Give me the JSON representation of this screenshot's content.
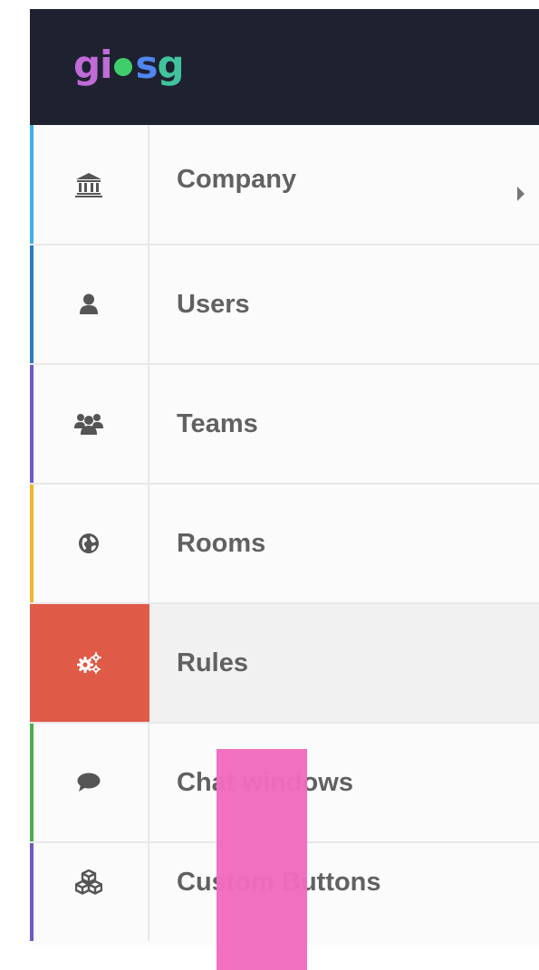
{
  "brand": {
    "logo_text_left": "gi",
    "logo_text_right": "sg",
    "logo_label": "giosg",
    "colors": {
      "left": "#c06bd6",
      "dot": "#3fce6b",
      "s": "#4f86f0",
      "g": "#41c39d"
    }
  },
  "menu": {
    "items": [
      {
        "label": "Company",
        "icon": "bank-icon",
        "accent": "#3fb0e8",
        "has_submenu": true,
        "active": false
      },
      {
        "label": "Users",
        "icon": "user-icon",
        "accent": "#2b7bbf",
        "has_submenu": false,
        "active": false
      },
      {
        "label": "Teams",
        "icon": "users-icon",
        "accent": "#6a5bc8",
        "has_submenu": false,
        "active": false
      },
      {
        "label": "Rooms",
        "icon": "globe-icon",
        "accent": "#f5b32d",
        "has_submenu": false,
        "active": false
      },
      {
        "label": "Rules",
        "icon": "gears-icon",
        "accent": "#e05a48",
        "has_submenu": false,
        "active": true
      },
      {
        "label": "Chat windows",
        "icon": "comment-icon",
        "accent": "#4cae4a",
        "has_submenu": false,
        "active": false
      },
      {
        "label": "Custom Buttons",
        "icon": "cubes-icon",
        "accent": "#6a5bc8",
        "has_submenu": false,
        "active": false
      }
    ]
  },
  "colors": {
    "header_bg": "#1d2130",
    "active_icon_bg": "#e05a48",
    "text": "#616161",
    "overlay": "#f16bbd"
  }
}
